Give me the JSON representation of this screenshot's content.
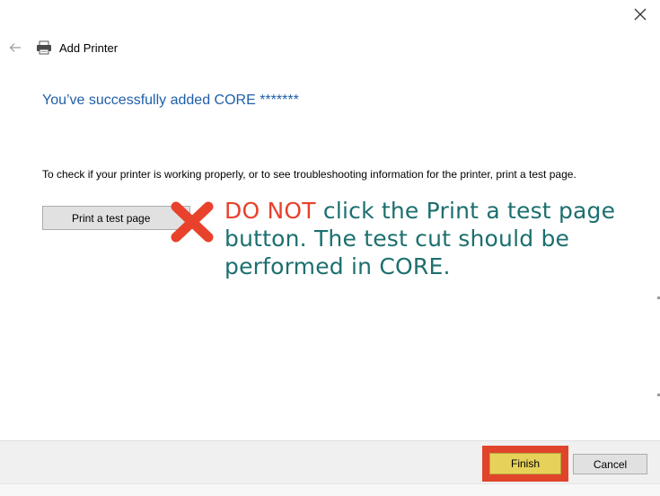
{
  "window": {
    "title": "Add Printer",
    "close_glyph": "✕",
    "back_glyph": "←"
  },
  "main": {
    "heading": "You’ve successfully added CORE *******",
    "description": "To check if your printer is working properly, or to see troubleshooting information for the printer, print a test page.",
    "print_test_label": "Print a test page"
  },
  "annotation": {
    "warning": "DO NOT",
    "rest": " click the Print a test page button. The test cut should be performed in CORE.",
    "warning_color": "#e8412c",
    "text_color": "#1d6f6f",
    "x_mark_color": "#e8412c"
  },
  "footer": {
    "finish_label": "Finish",
    "cancel_label": "Cancel",
    "highlight_color": "#e0442b",
    "finish_fill": "#e6d25a"
  },
  "icons": [
    "close-icon",
    "back-arrow-icon",
    "printer-icon",
    "x-mark-icon"
  ]
}
